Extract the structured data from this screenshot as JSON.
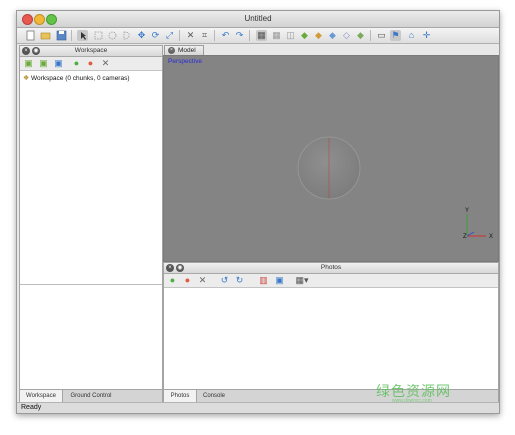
{
  "window": {
    "title": "Untitled"
  },
  "workspace_pane": {
    "title": "Workspace",
    "tree_item": "Workspace (0 chunks, 0 cameras)",
    "tabs": [
      "Workspace",
      "Ground Control"
    ]
  },
  "model_view": {
    "tab": "Model",
    "label": "Perspective"
  },
  "photos_pane": {
    "title": "Photos",
    "tabs": [
      "Photos",
      "Console"
    ]
  },
  "status_bar": {
    "text": "Ready"
  },
  "watermark": {
    "text": "绿色资源网",
    "url": "www.downcc.com"
  }
}
